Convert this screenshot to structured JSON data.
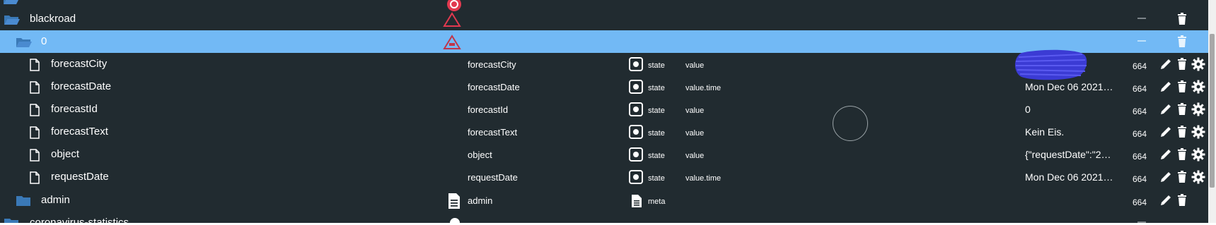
{
  "tree": {
    "top_partial_row": {},
    "blackroad": {
      "label": "blackroad"
    },
    "channel_0": {
      "label": "0"
    },
    "states": [
      {
        "name": "forecastCity",
        "id": "forecastCity",
        "type": "state",
        "role": "value",
        "value": "",
        "acl": "664"
      },
      {
        "name": "forecastDate",
        "id": "forecastDate",
        "type": "state",
        "role": "value.time",
        "value": "Mon Dec 06 2021…",
        "acl": "664"
      },
      {
        "name": "forecastId",
        "id": "forecastId",
        "type": "state",
        "role": "value",
        "value": "0",
        "acl": "664"
      },
      {
        "name": "forecastText",
        "id": "forecastText",
        "type": "state",
        "role": "value",
        "value": "Kein Eis.",
        "acl": "664"
      },
      {
        "name": "object",
        "id": "object",
        "type": "state",
        "role": "value",
        "value": "{\"requestDate\":\"2…",
        "acl": "664"
      },
      {
        "name": "requestDate",
        "id": "requestDate",
        "type": "state",
        "role": "value.time",
        "value": "Mon Dec 06 2021…",
        "acl": "664"
      }
    ],
    "admin": {
      "name": "admin",
      "id": "admin",
      "type": "meta",
      "acl": "664"
    },
    "bottom_partial_row": {
      "label": "coronavirus-statistics"
    }
  },
  "icons": {
    "folder": "folder-icon",
    "folder_open": "folder-open-icon",
    "file": "file-icon",
    "state": "state-icon",
    "meta": "document-icon",
    "role_warning": "warning-triangle-icon",
    "role_channel": "channel-triangle-icon",
    "edit": "pencil-icon",
    "delete": "trash-icon",
    "settings": "gear-icon"
  },
  "colors": {
    "background": "#212b30",
    "selected_row": "#72b9f5",
    "folder": "#3a79b7",
    "role_warning": "#e2394f",
    "text": "#ffffff",
    "scribble": "#3b3bd4"
  }
}
